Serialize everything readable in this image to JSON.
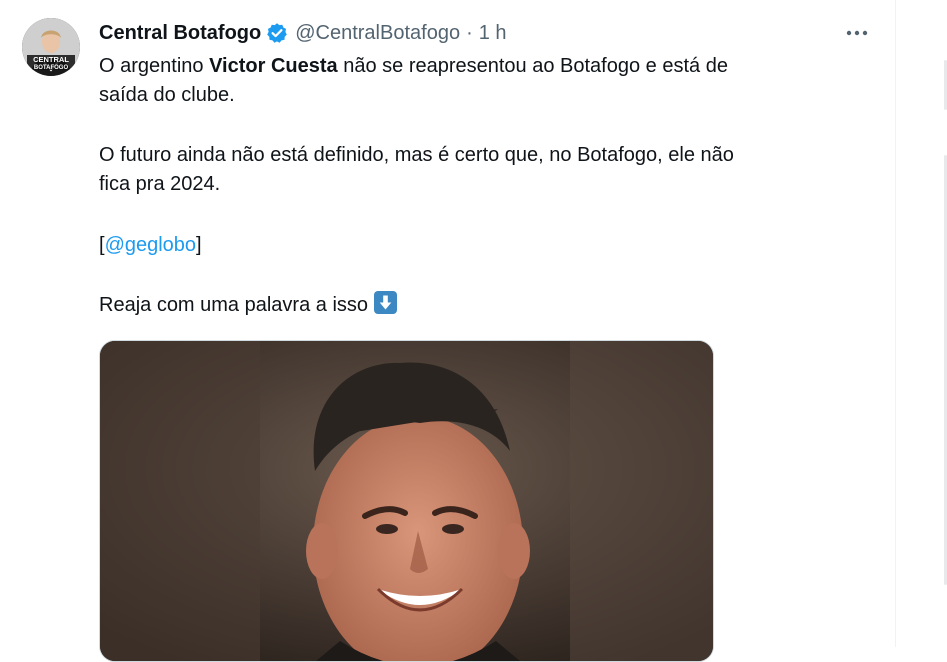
{
  "tweet": {
    "display_name": "Central Botafogo",
    "handle": "@CentralBotafogo",
    "separator": "·",
    "time": "1 h",
    "avatar_text_line1": "CENTRAL",
    "avatar_text_line2": "BOTAFOGO",
    "body": {
      "line1_prefix": "O argentino ",
      "line1_bold": "Victor Cuesta",
      "line1_suffix": " não se reapresentou ao Botafogo e está de",
      "line2": "saída do clube.",
      "line3": "O futuro ainda não está definido, mas é certo que, no Botafogo, ele não",
      "line4": "fica pra 2024.",
      "mention_open": "[",
      "mention": "@geglobo",
      "mention_close": "]",
      "line6": "Reaja com uma palavra a isso"
    },
    "media_alt": "Smiling football player with spiked dark hair"
  },
  "icons": {
    "verified": "verified-badge-icon",
    "more": "more-horizontal-icon",
    "arrow_down_emoji": "arrow-down-emoji-icon"
  },
  "colors": {
    "text": "#0f1419",
    "secondary": "#536471",
    "link": "#1d9bf0",
    "verified": "#1d9bf0",
    "border": "#cfd9de"
  }
}
